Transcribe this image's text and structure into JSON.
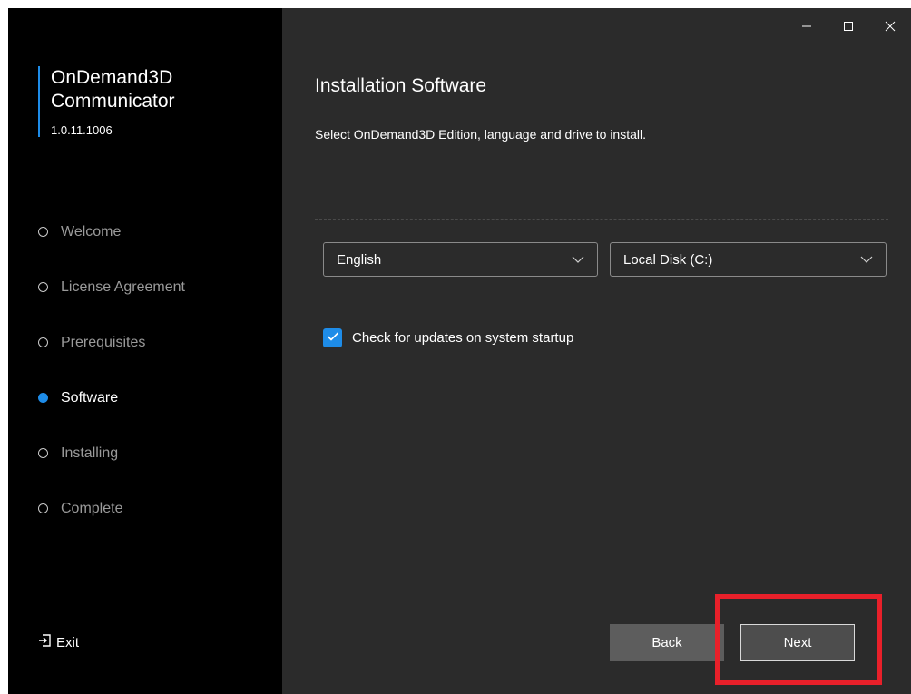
{
  "app": {
    "name_line1": "OnDemand3D",
    "name_line2": "Communicator",
    "version": "1.0.11.1006"
  },
  "steps": [
    {
      "label": "Welcome",
      "active": false
    },
    {
      "label": "License Agreement",
      "active": false
    },
    {
      "label": "Prerequisites",
      "active": false
    },
    {
      "label": "Software",
      "active": true
    },
    {
      "label": "Installing",
      "active": false
    },
    {
      "label": "Complete",
      "active": false
    }
  ],
  "exit_label": "Exit",
  "main": {
    "title": "Installation Software",
    "subtitle": "Select OnDemand3D Edition, language and drive to install.",
    "language_select": {
      "value": "English"
    },
    "drive_select": {
      "value": "Local Disk (C:)"
    },
    "update_checkbox": {
      "label": "Check for updates on system startup",
      "checked": true
    }
  },
  "buttons": {
    "back": "Back",
    "next": "Next"
  },
  "colors": {
    "accent": "#1e8ce8",
    "highlight": "#e8202a",
    "sidebar_bg": "#000000",
    "main_bg": "#2b2b2b"
  },
  "icons": {
    "minimize": "minimize-icon",
    "maximize": "maximize-icon",
    "close": "close-icon",
    "exit": "exit-icon",
    "dropdown": "chevron-down-icon",
    "check": "check-icon"
  }
}
